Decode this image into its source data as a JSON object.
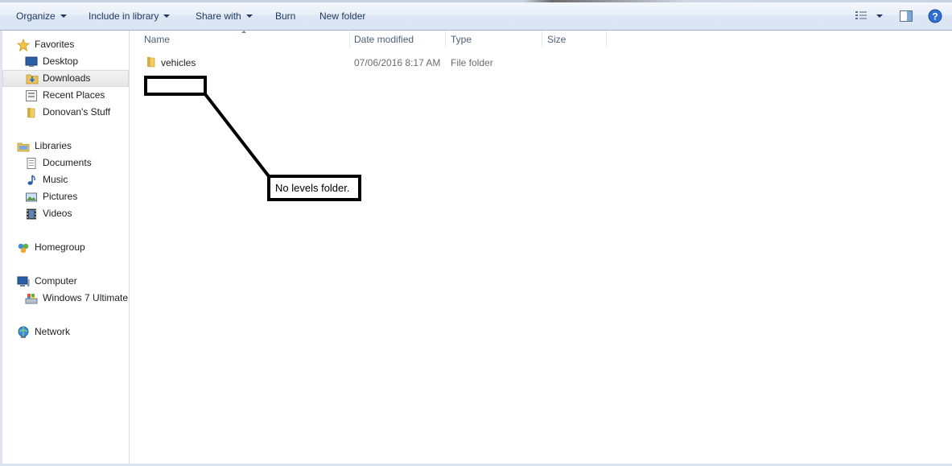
{
  "toolbar": {
    "organize": "Organize",
    "include_in_library": "Include in library",
    "share_with": "Share with",
    "burn": "Burn",
    "new_folder": "New folder"
  },
  "nav": {
    "favorites": "Favorites",
    "desktop": "Desktop",
    "downloads": "Downloads",
    "recent_places": "Recent Places",
    "donovans_stuff": "Donovan's Stuff",
    "libraries": "Libraries",
    "documents": "Documents",
    "music": "Music",
    "pictures": "Pictures",
    "videos": "Videos",
    "homegroup": "Homegroup",
    "computer": "Computer",
    "windows7": "Windows 7 Ultimate",
    "network": "Network"
  },
  "columns": {
    "name": "Name",
    "date_modified": "Date modified",
    "type": "Type",
    "size": "Size"
  },
  "files": [
    {
      "name": "vehicles",
      "date_modified": "07/06/2016 8:17 AM",
      "type": "File folder",
      "size": ""
    }
  ],
  "annotation": {
    "text": "No levels folder."
  },
  "colors": {
    "toolbar_text": "#1e395b",
    "folder_yellow": "#e8c35a",
    "help_blue": "#2f6fd0",
    "selection_gray": "#e6e6e6"
  }
}
